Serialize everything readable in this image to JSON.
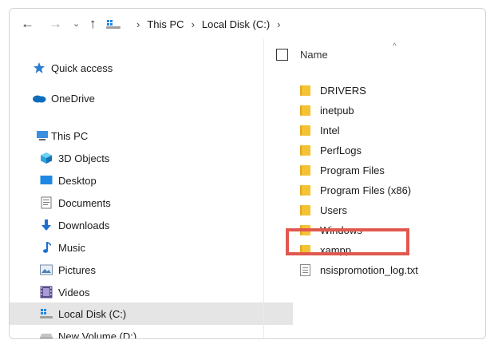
{
  "toolbar": {
    "back_icon": "arrow-left-icon",
    "forward_icon": "arrow-right-icon",
    "recent_icon": "chevron-down-icon",
    "up_icon": "arrow-up-icon",
    "breadcrumb": [
      "This PC",
      "Local Disk (C:)"
    ]
  },
  "sidebar": {
    "items": [
      {
        "label": "Quick access",
        "icon": "star-icon"
      },
      {
        "label": "OneDrive",
        "icon": "cloud-icon"
      },
      {
        "label": "This PC",
        "icon": "computer-icon"
      },
      {
        "label": "3D Objects",
        "icon": "cube-icon"
      },
      {
        "label": "Desktop",
        "icon": "desktop-icon"
      },
      {
        "label": "Documents",
        "icon": "documents-icon"
      },
      {
        "label": "Downloads",
        "icon": "download-icon"
      },
      {
        "label": "Music",
        "icon": "music-icon"
      },
      {
        "label": "Pictures",
        "icon": "pictures-icon"
      },
      {
        "label": "Videos",
        "icon": "videos-icon"
      },
      {
        "label": "Local Disk (C:)",
        "icon": "local-disk-icon",
        "selected": true
      },
      {
        "label": "New Volume (D:)",
        "icon": "drive-icon"
      }
    ]
  },
  "content": {
    "column_header": "Name",
    "files": [
      {
        "name": "DRIVERS",
        "type": "folder"
      },
      {
        "name": "inetpub",
        "type": "folder"
      },
      {
        "name": "Intel",
        "type": "folder"
      },
      {
        "name": "PerfLogs",
        "type": "folder"
      },
      {
        "name": "Program Files",
        "type": "folder"
      },
      {
        "name": "Program Files (x86)",
        "type": "folder"
      },
      {
        "name": "Users",
        "type": "folder"
      },
      {
        "name": "Windows",
        "type": "folder"
      },
      {
        "name": "xampp",
        "type": "folder",
        "highlighted": true
      },
      {
        "name": "nsispromotion_log.txt",
        "type": "text"
      }
    ]
  },
  "colors": {
    "highlight_border": "#e0584e",
    "selection_bg": "#e5e5e5",
    "folder": "#f5c233"
  }
}
